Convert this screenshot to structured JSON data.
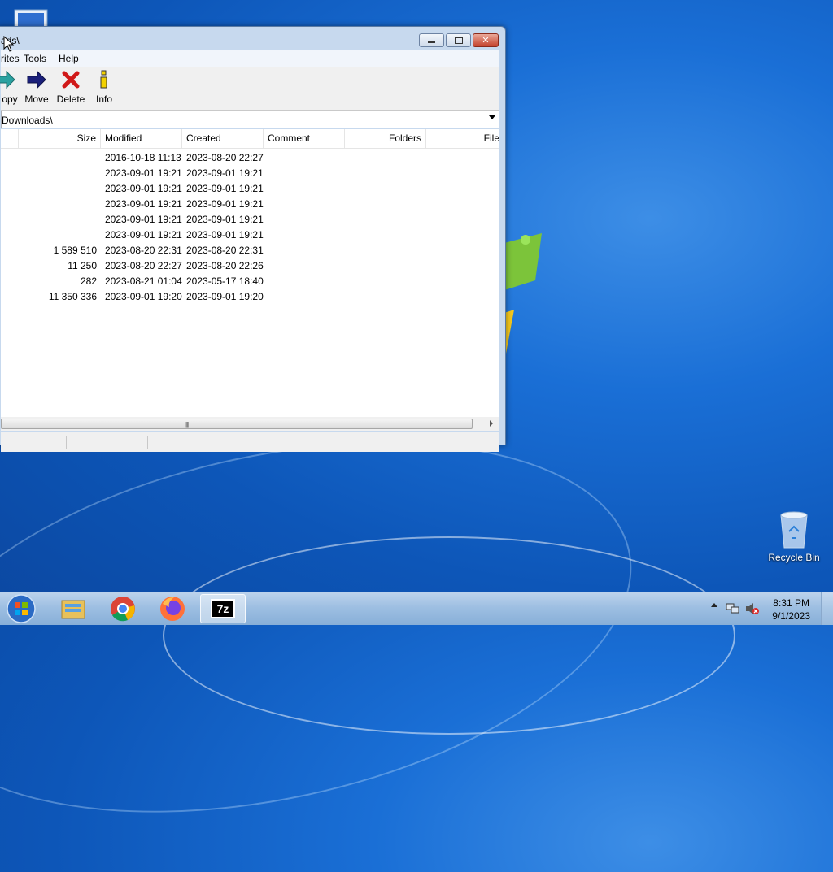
{
  "window": {
    "title": "ads\\",
    "menu": [
      "rites",
      "Tools",
      "Help"
    ],
    "toolbar": [
      {
        "label": "opy",
        "icon": "copy-arrow-icon"
      },
      {
        "label": "Move",
        "icon": "move-arrow-icon"
      },
      {
        "label": "Delete",
        "icon": "delete-x-icon"
      },
      {
        "label": "Info",
        "icon": "info-icon"
      }
    ],
    "address": "Downloads\\",
    "columns": [
      "Size",
      "Modified",
      "Created",
      "Comment",
      "Folders",
      "File"
    ],
    "rows": [
      {
        "size": "",
        "modified": "2016-10-18 11:13",
        "created": "2023-08-20 22:27"
      },
      {
        "size": "",
        "modified": "2023-09-01 19:21",
        "created": "2023-09-01 19:21"
      },
      {
        "size": "",
        "modified": "2023-09-01 19:21",
        "created": "2023-09-01 19:21"
      },
      {
        "size": "",
        "modified": "2023-09-01 19:21",
        "created": "2023-09-01 19:21"
      },
      {
        "size": "",
        "modified": "2023-09-01 19:21",
        "created": "2023-09-01 19:21"
      },
      {
        "size": "",
        "modified": "2023-09-01 19:21",
        "created": "2023-09-01 19:21"
      },
      {
        "size": "1 589 510",
        "modified": "2023-08-20 22:31",
        "created": "2023-08-20 22:31"
      },
      {
        "size": "11 250",
        "modified": "2023-08-20 22:27",
        "created": "2023-08-20 22:26"
      },
      {
        "size": "282",
        "modified": "2023-08-21 01:04",
        "created": "2023-05-17 18:40"
      },
      {
        "size": "11 350 336",
        "modified": "2023-09-01 19:20",
        "created": "2023-09-01 19:20"
      }
    ]
  },
  "desktop": {
    "recycle_bin": "Recycle Bin"
  },
  "taskbar": {
    "apps": [
      "windows-explorer-icon",
      "chrome-icon",
      "firefox-icon",
      "7zip-icon"
    ],
    "app7z_text": "7z",
    "time": "8:31 PM",
    "date": "9/1/2023"
  }
}
